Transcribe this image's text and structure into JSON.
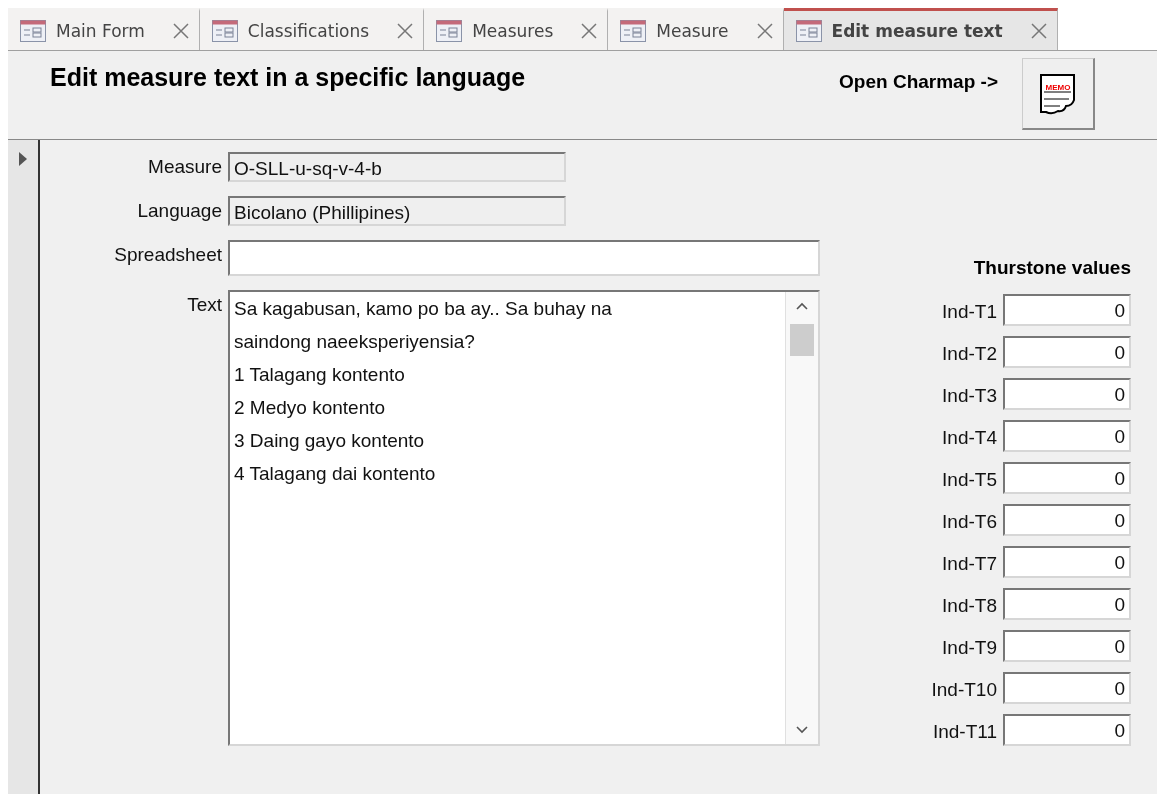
{
  "tabs": [
    {
      "label": "Main Form",
      "selected": false
    },
    {
      "label": "Classifications",
      "selected": false
    },
    {
      "label": "Measures",
      "selected": false
    },
    {
      "label": "Measure",
      "selected": false
    },
    {
      "label": "Edit measure text",
      "selected": true
    }
  ],
  "header": {
    "title": "Edit measure text in a specific language",
    "charmap_label": "Open Charmap ->",
    "memo_button": "MEMO"
  },
  "form": {
    "measure": {
      "label": "Measure",
      "value": "O-SLL-u-sq-v-4-b"
    },
    "language": {
      "label": "Language",
      "value": "Bicolano (Phillipines)"
    },
    "spreadsheet": {
      "label": "Spreadsheet"
    },
    "text": {
      "label": "Text",
      "value": "Sa kagabusan, kamo po ba ay.. Sa buhay na saindong naeeksperiyensia?\n1 Talagang kontento\n2 Medyo kontento\n3 Daing gayo kontento\n4 Talagang dai kontento"
    }
  },
  "thurstone": {
    "title": "Thurstone values",
    "rows": [
      {
        "label": "Ind-T1",
        "value": "0"
      },
      {
        "label": "Ind-T2",
        "value": "0"
      },
      {
        "label": "Ind-T3",
        "value": "0"
      },
      {
        "label": "Ind-T4",
        "value": "0"
      },
      {
        "label": "Ind-T5",
        "value": "0"
      },
      {
        "label": "Ind-T6",
        "value": "0"
      },
      {
        "label": "Ind-T7",
        "value": "0"
      },
      {
        "label": "Ind-T8",
        "value": "0"
      },
      {
        "label": "Ind-T9",
        "value": "0"
      },
      {
        "label": "Ind-T10",
        "value": "0"
      },
      {
        "label": "Ind-T11",
        "value": "0"
      }
    ]
  }
}
